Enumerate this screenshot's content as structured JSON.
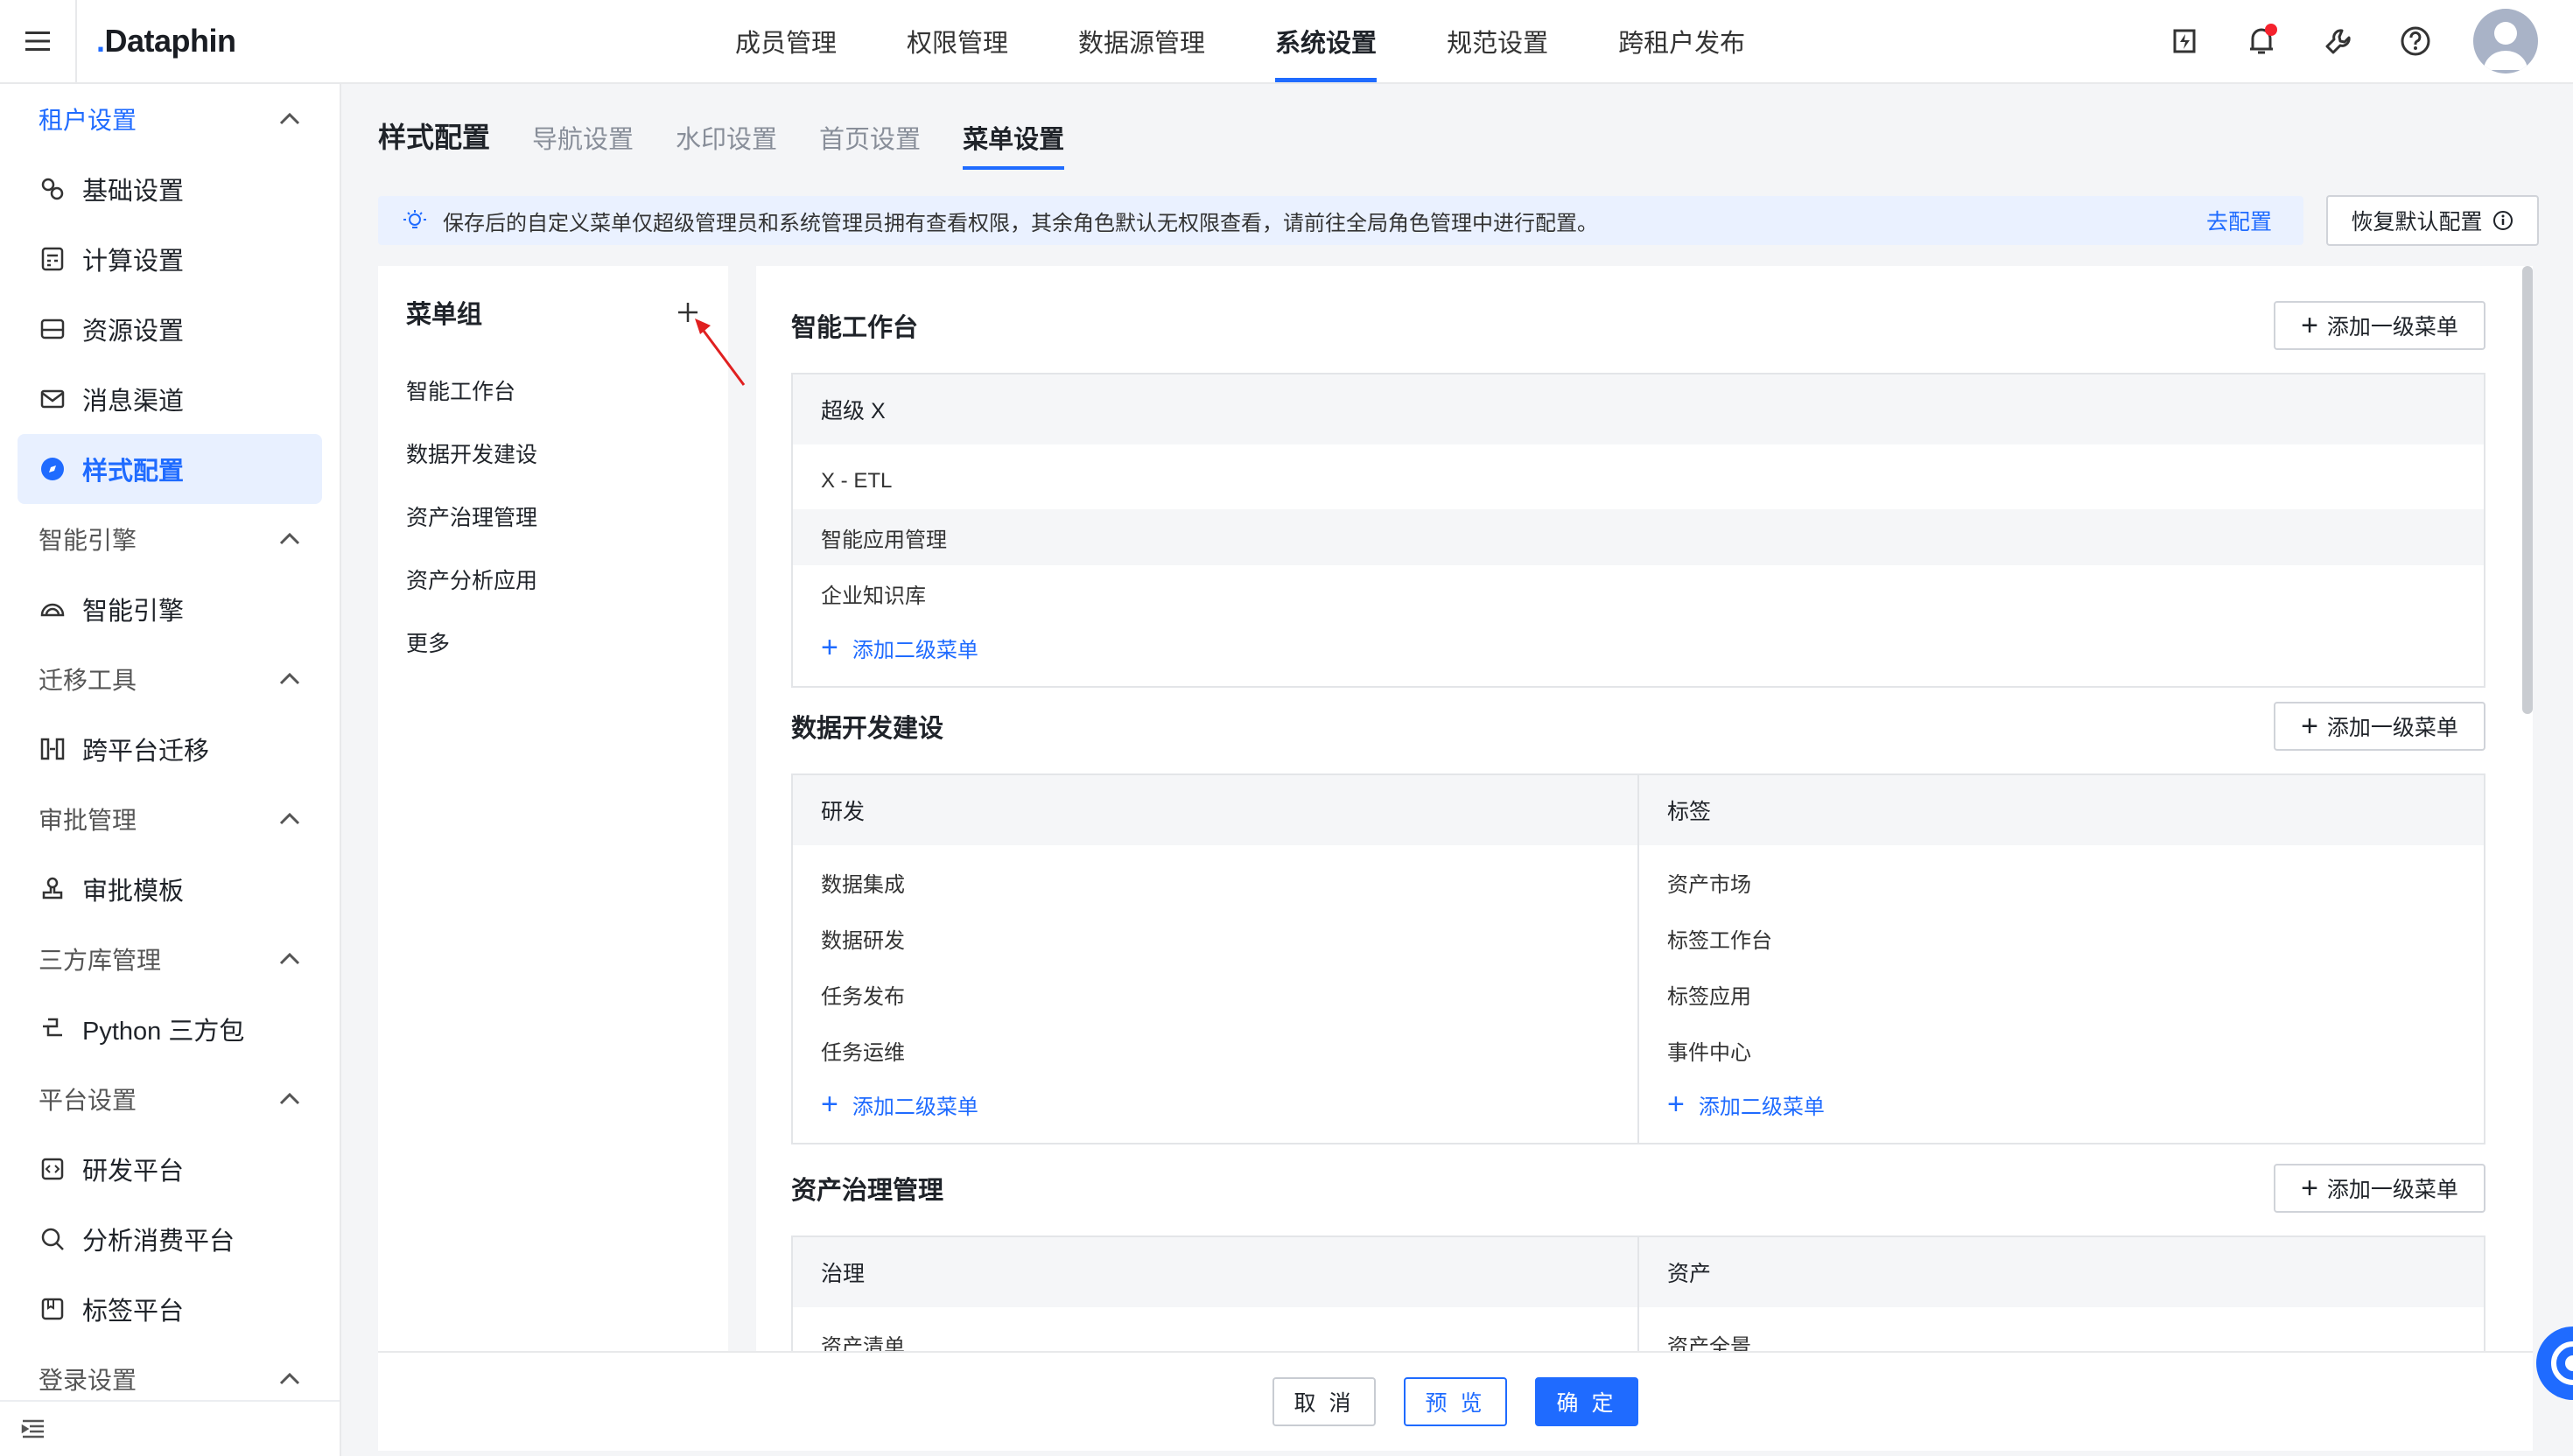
{
  "app": {
    "logo": "Dataphin"
  },
  "topnav": {
    "items": [
      "成员管理",
      "权限管理",
      "数据源管理",
      "系统设置",
      "规范设置",
      "跨租户发布"
    ],
    "active_index": 3
  },
  "sidebar": {
    "groups": [
      {
        "label": "租户设置",
        "items": [
          {
            "label": "基础设置",
            "icon": "gear-cluster-icon"
          },
          {
            "label": "计算设置",
            "icon": "calculator-icon"
          },
          {
            "label": "资源设置",
            "icon": "drive-icon"
          },
          {
            "label": "消息渠道",
            "icon": "mail-icon"
          },
          {
            "label": "样式配置",
            "icon": "compass-icon"
          }
        ]
      },
      {
        "label": "智能引擎",
        "items": [
          {
            "label": "智能引擎",
            "icon": "engine-icon"
          }
        ]
      },
      {
        "label": "迁移工具",
        "items": [
          {
            "label": "跨平台迁移",
            "icon": "migrate-icon"
          }
        ]
      },
      {
        "label": "审批管理",
        "items": [
          {
            "label": "审批模板",
            "icon": "stamp-icon"
          }
        ]
      },
      {
        "label": "三方库管理",
        "items": [
          {
            "label": "Python 三方包",
            "icon": "python-icon"
          }
        ]
      },
      {
        "label": "平台设置",
        "items": [
          {
            "label": "研发平台",
            "icon": "code-icon"
          },
          {
            "label": "分析消费平台",
            "icon": "analysis-icon"
          },
          {
            "label": "标签平台",
            "icon": "tag-icon"
          }
        ]
      },
      {
        "label": "登录设置",
        "items": []
      }
    ],
    "active_item": "样式配置"
  },
  "tabs": {
    "title": "样式配置",
    "items": [
      "导航设置",
      "水印设置",
      "首页设置",
      "菜单设置"
    ],
    "active_index": 3
  },
  "notice": {
    "text": "保存后的自定义菜单仅超级管理员和系统管理员拥有查看权限，其余角色默认无权限查看，请前往全局角色管理中进行配置。",
    "link": "去配置",
    "restore_label": "恢复默认配置"
  },
  "menu_group": {
    "title": "菜单组",
    "items": [
      "智能工作台",
      "数据开发建设",
      "资产治理管理",
      "资产分析应用",
      "更多"
    ]
  },
  "sections": [
    {
      "title": "智能工作台",
      "add_label": "添加一级菜单",
      "columns": [
        {
          "head": "超级 X",
          "items": [
            "X - ETL",
            "智能应用管理",
            "企业知识库"
          ],
          "add_label": "添加二级菜单"
        }
      ]
    },
    {
      "title": "数据开发建设",
      "add_label": "添加一级菜单",
      "columns": [
        {
          "head": "研发",
          "items": [
            "数据集成",
            "数据研发",
            "任务发布",
            "任务运维"
          ],
          "add_label": "添加二级菜单"
        },
        {
          "head": "标签",
          "items": [
            "资产市场",
            "标签工作台",
            "标签应用",
            "事件中心"
          ],
          "add_label": "添加二级菜单"
        }
      ]
    },
    {
      "title": "资产治理管理",
      "add_label": "添加一级菜单",
      "columns": [
        {
          "head": "治理",
          "items": [
            "资产清单"
          ]
        },
        {
          "head": "资产",
          "items": [
            "资产全景"
          ]
        }
      ]
    }
  ],
  "footer": {
    "cancel": "取 消",
    "preview": "预 览",
    "confirm": "确 定"
  },
  "colors": {
    "primary": "#1f6bff",
    "notice_bg": "#eaf1ff",
    "alert_dot": "#f5222d"
  }
}
